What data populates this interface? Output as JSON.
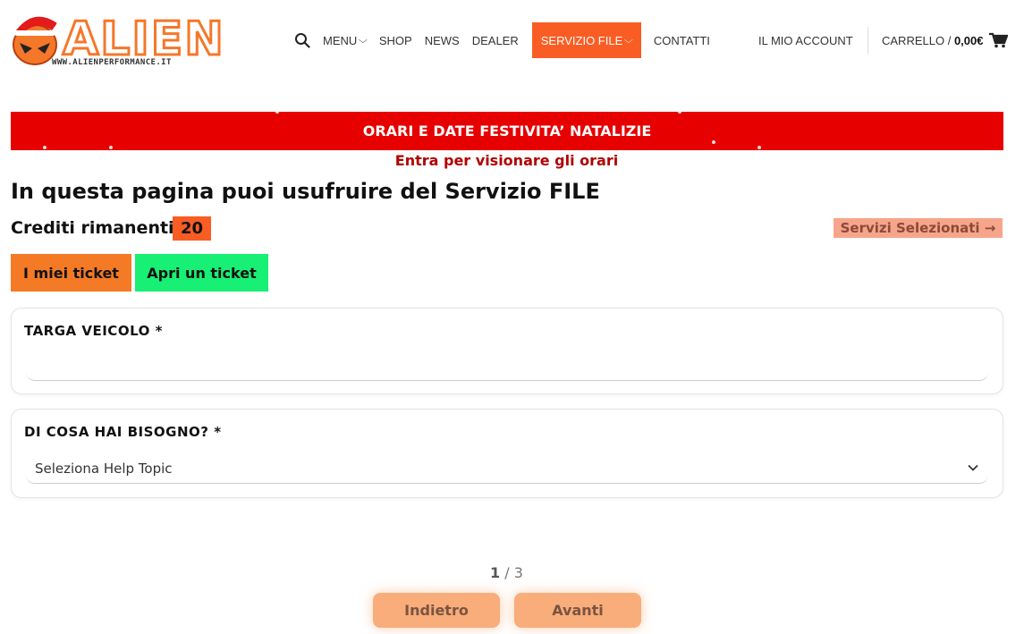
{
  "header": {
    "logo_text": "ALIEN",
    "logo_url": "WWW.ALIENPERFORMANCE.IT",
    "nav": {
      "menu": "MENU",
      "shop": "SHOP",
      "news": "NEWS",
      "dealer": "DEALER",
      "servizio_file": "SERVIZIO FILE",
      "contatti": "CONTATTI"
    },
    "account": "IL MIO ACCOUNT",
    "cart_label": "CARRELLO /",
    "cart_total": "0,00€"
  },
  "banner": {
    "title": "ORARI E DATE FESTIVITA’ NATALIZIE",
    "subtitle": "Entra per visionare gli orari"
  },
  "main": {
    "page_title": "In questa pagina puoi usufruire del Servizio FILE",
    "credits_label": "Crediti rimanenti:",
    "credits_value": "20",
    "selected_services": "Servizi Selezionati →",
    "my_tickets": "I miei ticket",
    "open_ticket": "Apri un ticket"
  },
  "form": {
    "plate_label": "TARGA VEICOLO *",
    "plate_value": "",
    "need_label": "DI COSA HAI BISOGNO? *",
    "need_selected": "Seleziona Help Topic"
  },
  "pager": {
    "current": "1",
    "separator": "/",
    "total": "3",
    "back": "Indietro",
    "next": "Avanti"
  },
  "colors": {
    "accent": "#f95d24",
    "banner_red": "#e60000",
    "green": "#17f074",
    "orange_button": "#f57a25"
  }
}
